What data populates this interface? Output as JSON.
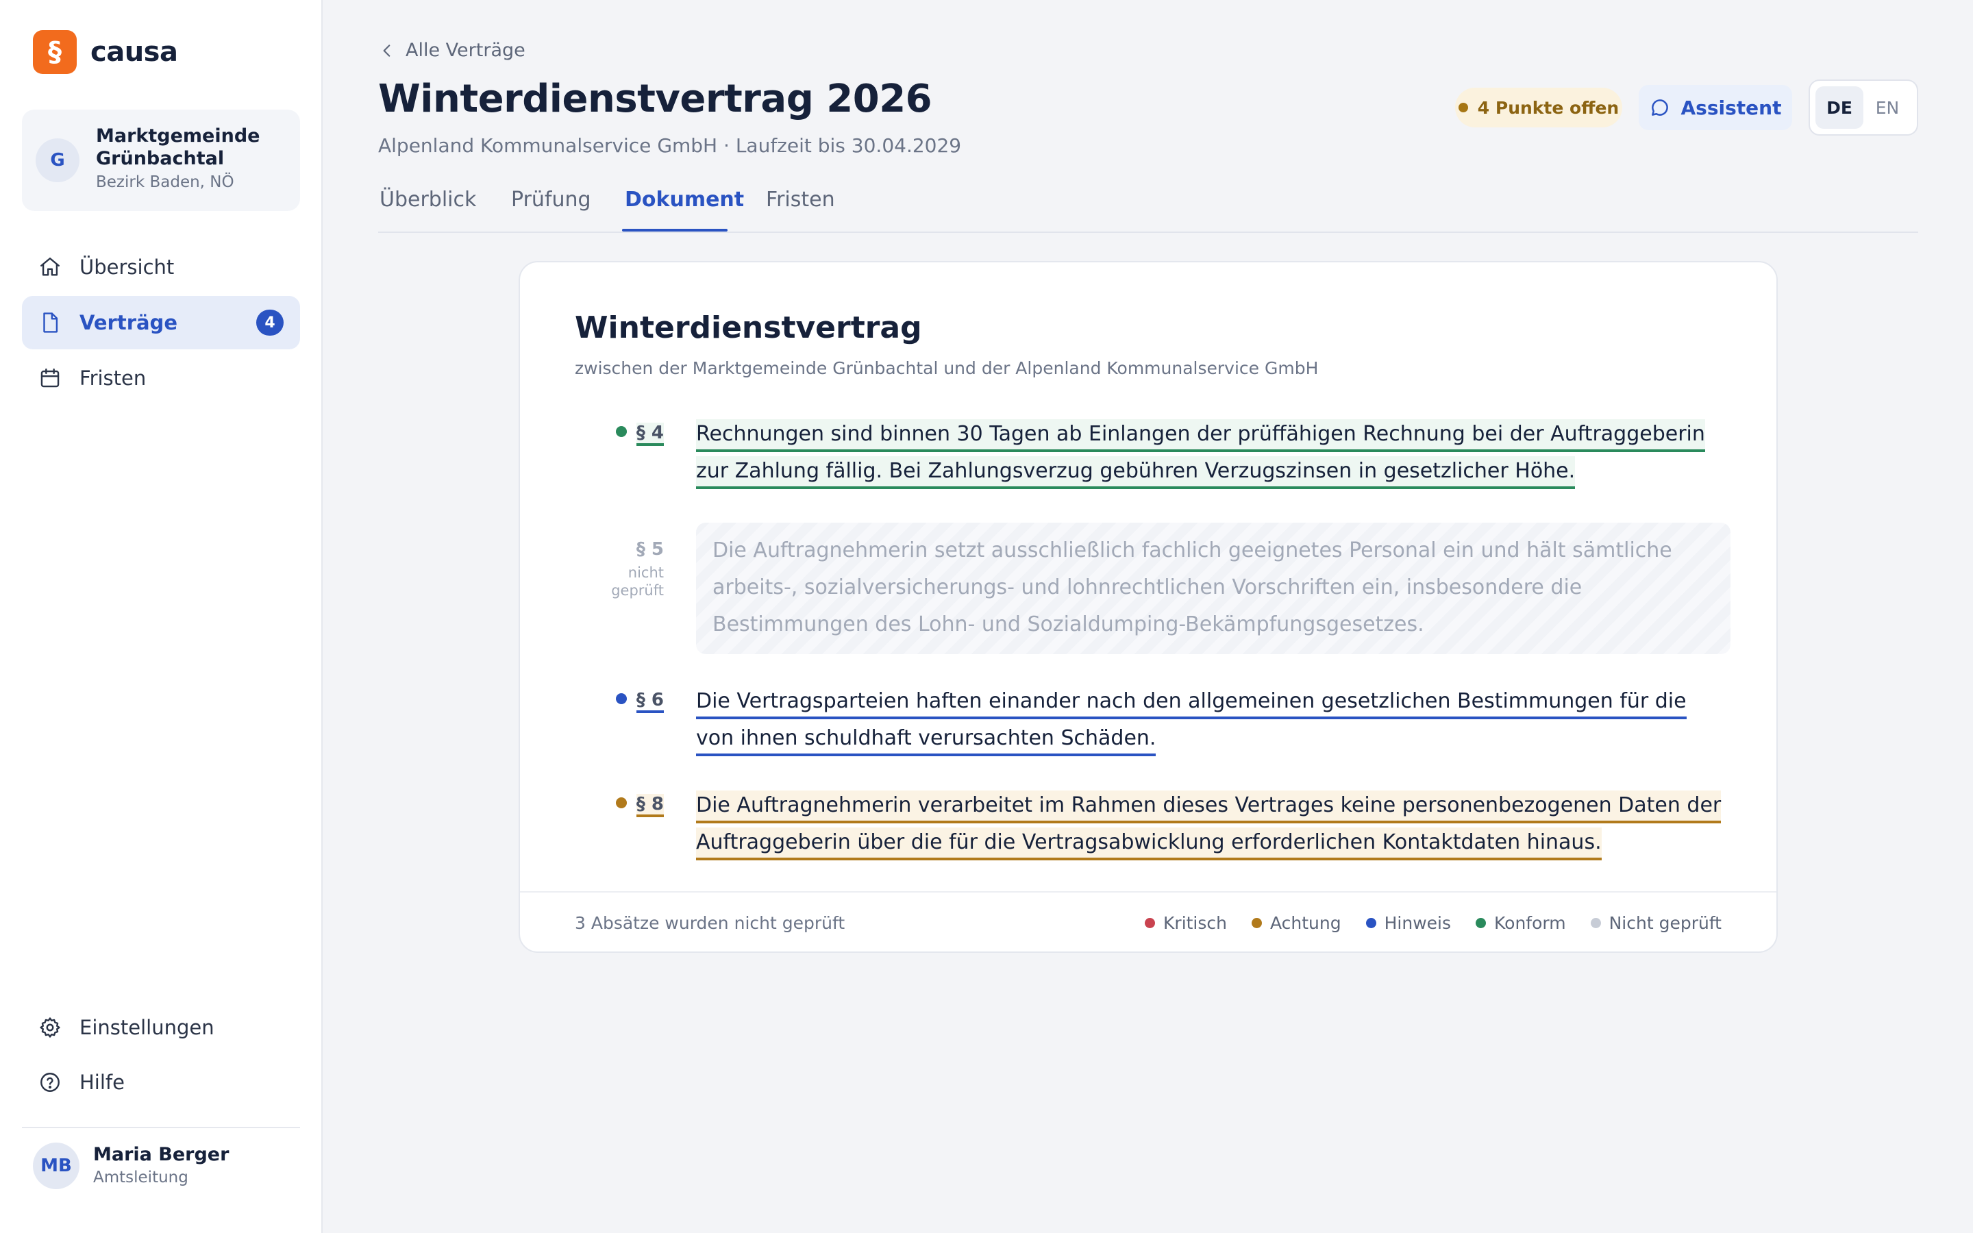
{
  "app": {
    "logo_glyph": "§",
    "name": "causa",
    "brand_color": "#f26b1d",
    "accent_color": "#2a53c2"
  },
  "org": {
    "avatar": "G",
    "name": "Marktgemeinde Grünbachtal",
    "region": "Bezirk Baden, NÖ"
  },
  "nav": {
    "items": [
      {
        "label": "Übersicht",
        "icon": "home-icon"
      },
      {
        "label": "Verträge",
        "icon": "document-icon",
        "badge": "4",
        "active": true
      },
      {
        "label": "Fristen",
        "icon": "calendar-icon"
      }
    ],
    "bottom": [
      {
        "label": "Einstellungen",
        "icon": "gear-icon"
      },
      {
        "label": "Hilfe",
        "icon": "help-icon"
      }
    ]
  },
  "user": {
    "initials": "MB",
    "name": "Maria Berger",
    "role": "Amtsleitung"
  },
  "header": {
    "back_label": "Alle Verträge",
    "title": "Winterdienstvertrag 2026",
    "subtitle": "Alpenland Kommunalservice GmbH · Laufzeit bis 30.04.2029",
    "status": "4 Punkte offen",
    "assistant_label": "Assistent",
    "languages": [
      {
        "code": "DE",
        "active": true
      },
      {
        "code": "EN",
        "active": false
      }
    ]
  },
  "tabs": [
    {
      "label": "Überblick"
    },
    {
      "label": "Prüfung"
    },
    {
      "label": "Dokument",
      "active": true
    },
    {
      "label": "Fristen"
    }
  ],
  "document": {
    "title": "Winterdienstvertrag",
    "subtitle": "zwischen der Marktgemeinde Grünbachtal und der Alpenland Kommunalservice GmbH",
    "clauses": [
      {
        "section": "§ 4",
        "status": "Konform",
        "text": "Rechnungen sind binnen 30 Tagen ab Einlangen der prüffähigen Rechnung bei der Auftraggeberin zur Zahlung fällig. Bei Zahlungsverzug gebühren Verzugszinsen in gesetzlicher Höhe."
      },
      {
        "section": "§ 5",
        "status": "Nicht geprüft",
        "note": "nicht geprüft",
        "text": "Die Auftragnehmerin setzt ausschließlich fachlich geeignetes Personal ein und hält sämtliche arbeits-, sozialversicherungs- und lohnrechtlichen Vorschriften ein, insbesondere die Bestimmungen des Lohn- und Sozialdumping-Bekämpfungsgesetzes."
      },
      {
        "section": "§ 6",
        "status": "Hinweis",
        "text": "Die Vertragsparteien haften einander nach den allgemeinen gesetzlichen Bestimmungen für die von ihnen schuldhaft verursachten Schäden."
      },
      {
        "section": "§ 8",
        "status": "Achtung",
        "text": "Die Auftragnehmerin verarbeitet im Rahmen dieses Vertrages keine personenbezogenen Daten der Auftraggeberin über die für die Vertragsabwicklung erforderlichen Kontaktdaten hinaus."
      }
    ],
    "footer_note": "3 Absätze wurden nicht geprüft",
    "legend": [
      {
        "label": "Kritisch",
        "color": "#c9434f"
      },
      {
        "label": "Achtung",
        "color": "#b17a1b"
      },
      {
        "label": "Hinweis",
        "color": "#2a53c2"
      },
      {
        "label": "Konform",
        "color": "#2a8a5c"
      },
      {
        "label": "Nicht geprüft",
        "color": "#c7ccd6"
      }
    ]
  }
}
